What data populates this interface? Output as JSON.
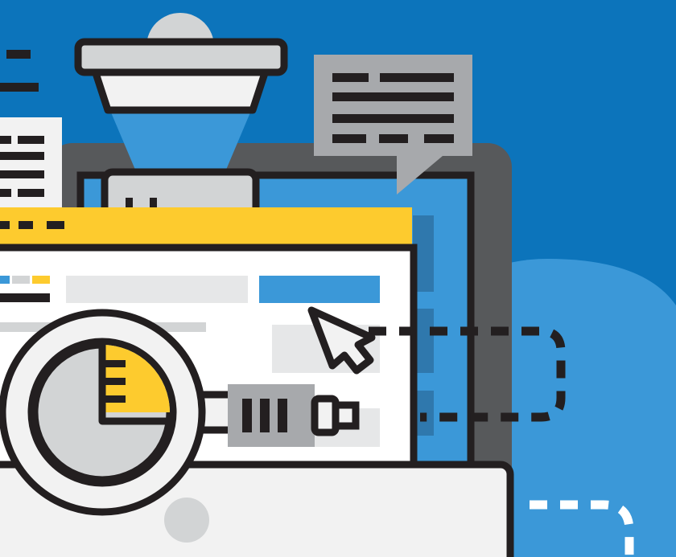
{
  "colors": {
    "background": "#0c74bb",
    "background_blob": "#3b98d8",
    "outline": "#231f20",
    "monitor_frame": "#57595b",
    "screen": "#3b98d8",
    "screen_panel": "#2f78ad",
    "yellow": "#fdcb2e",
    "light_gray": "#d2d4d5",
    "mid_gray": "#a7a9ac",
    "paper": "#f2f2f2",
    "white": "#ffffff"
  },
  "icons": [
    "lamp-icon",
    "paper-document-icon",
    "speech-bubble-icon",
    "monitor-icon",
    "browser-window-icon",
    "magnifier-icon",
    "pie-chart-icon",
    "plug-icon",
    "cursor-arrow-icon",
    "dashed-cable-icon",
    "webcam-icon"
  ]
}
